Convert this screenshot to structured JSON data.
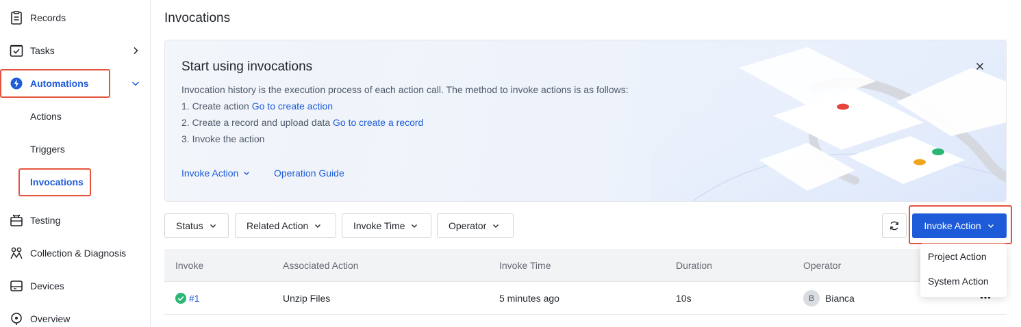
{
  "sidebar": {
    "items": [
      {
        "label": "Records",
        "icon": "clipboard-icon"
      },
      {
        "label": "Tasks",
        "icon": "task-check-icon"
      },
      {
        "label": "Automations",
        "icon": "automation-icon"
      },
      {
        "label": "Actions"
      },
      {
        "label": "Triggers"
      },
      {
        "label": "Invocations"
      },
      {
        "label": "Testing",
        "icon": "briefcase-icon"
      },
      {
        "label": "Collection & Diagnosis",
        "icon": "diagnosis-icon"
      },
      {
        "label": "Devices",
        "icon": "device-icon"
      },
      {
        "label": "Overview",
        "icon": "overview-icon"
      }
    ]
  },
  "page": {
    "title": "Invocations"
  },
  "banner": {
    "title": "Start using invocations",
    "intro": "Invocation history is the execution process of each action call. The method to invoke actions is as follows:",
    "step1_text": "1. Create action ",
    "step1_link": "Go to create action",
    "step2_text": "2. Create a record and upload data ",
    "step2_link": "Go to create a record",
    "step3_text": "3. Invoke the action",
    "invoke_action_link": "Invoke Action",
    "operation_guide_link": "Operation Guide"
  },
  "filters": {
    "status": "Status",
    "related_action": "Related Action",
    "invoke_time": "Invoke Time",
    "operator": "Operator"
  },
  "toolbar": {
    "invoke_action_button": "Invoke Action"
  },
  "dropdown": {
    "options": [
      "Project Action",
      "System Action"
    ]
  },
  "table": {
    "columns": [
      "Invoke",
      "Associated Action",
      "Invoke Time",
      "Duration",
      "Operator"
    ],
    "rows": [
      {
        "invoke": "#1",
        "action": "Unzip Files",
        "time": "5 minutes ago",
        "duration": "10s",
        "operator_initial": "B",
        "operator": "Bianca",
        "status": "success"
      }
    ]
  },
  "colors": {
    "accent": "#1e5bd8",
    "highlight": "#e5533d",
    "success": "#2bb673"
  }
}
